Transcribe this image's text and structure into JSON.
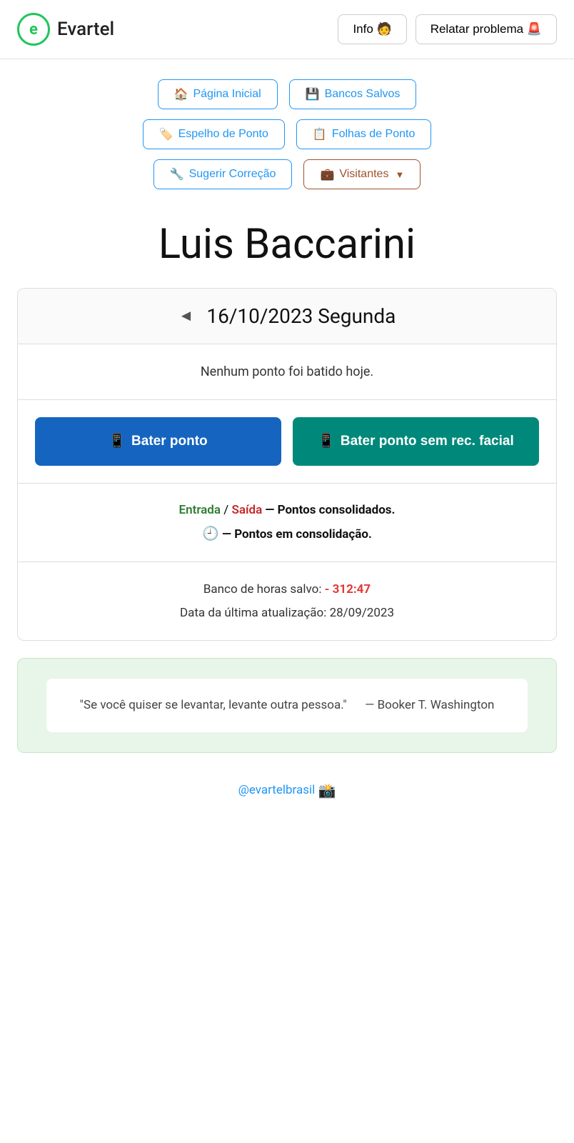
{
  "header": {
    "logo_letter": "e",
    "logo_name": "Evartel",
    "info_btn": "Info 🧑",
    "report_btn": "Relatar problema 🚨"
  },
  "nav": {
    "row1": [
      {
        "id": "pagina-inicial",
        "icon": "🏠",
        "label": "Página Inicial",
        "style": "blue"
      },
      {
        "id": "bancos-salvos",
        "icon": "💾",
        "label": "Bancos Salvos",
        "style": "blue"
      }
    ],
    "row2": [
      {
        "id": "espelho-de-ponto",
        "icon": "🏷️",
        "label": "Espelho de Ponto",
        "style": "blue"
      },
      {
        "id": "folhas-de-ponto",
        "icon": "📋",
        "label": "Folhas de Ponto",
        "style": "blue"
      }
    ],
    "row3": [
      {
        "id": "sugerir-correcao",
        "icon": "🔧",
        "label": "Sugerir Correção",
        "style": "blue"
      },
      {
        "id": "visitantes",
        "icon": "💼",
        "label": "Visitantes",
        "style": "brown",
        "hasChevron": true
      }
    ]
  },
  "page_title": "Luis Baccarini",
  "date_section": {
    "arrow_left": "◄",
    "date": "16/10/2023 Segunda"
  },
  "no_point_message": "Nenhum ponto foi batido hoje.",
  "buttons": {
    "bater_ponto": "Bater ponto",
    "bater_ponto_icon": "📱",
    "bater_ponto_sem": "Bater ponto sem rec. facial",
    "bater_ponto_sem_icon": "📱"
  },
  "legend": {
    "entrada": "Entrada",
    "slash": " / ",
    "saida": "Saída",
    "consolidados_text": " — Pontos consolidados.",
    "clock": "🕘",
    "consolidacao_text": " — Pontos em consolidação."
  },
  "bank": {
    "label": "Banco de horas salvo: ",
    "value": "- 312:47",
    "update_label": "Data da última atualização: ",
    "update_date": "28/09/2023"
  },
  "quote": {
    "text": "\"Se você quiser se levantar, levante outra pessoa.\"",
    "attribution": "— Booker T. Washington"
  },
  "footer": {
    "instagram_handle": "@evartelbrasil",
    "instagram_icon": "📷"
  }
}
